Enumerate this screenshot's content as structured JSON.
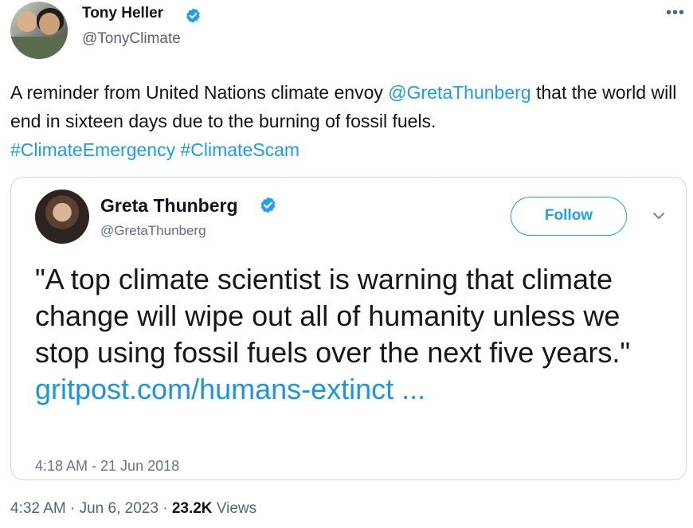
{
  "author": {
    "name": "Tony Heller",
    "handle": "@TonyClimate"
  },
  "more_icon": "more-horizontal-icon",
  "tweet": {
    "text_1": "A reminder from United Nations climate envoy ",
    "mention": "@GretaThunberg",
    "text_2": " that the world will end in sixteen days due to the burning of fossil fuels.",
    "hashtag_1": "#ClimateEmergency",
    "hashtag_2": "#ClimateScam"
  },
  "embedded_tweet": {
    "name": "Greta Thunberg",
    "handle": "@GretaThunberg",
    "follow_label": "Follow",
    "quote": "\"A top climate scientist is warning that climate change will wipe out all of humanity unless we stop using fossil fuels over the next five years.\"",
    "link": "gritpost.com/humans-extinct ...",
    "timestamp": "4:18 AM - 21 Jun 2018"
  },
  "footer": {
    "time": "4:32 AM",
    "date": "Jun 6, 2023",
    "separator": "·",
    "views_count": "23.2K",
    "views_label": "Views"
  },
  "colors": {
    "link": "#1d9bf0",
    "verified": "#1d9bf0",
    "muted": "#536471"
  }
}
